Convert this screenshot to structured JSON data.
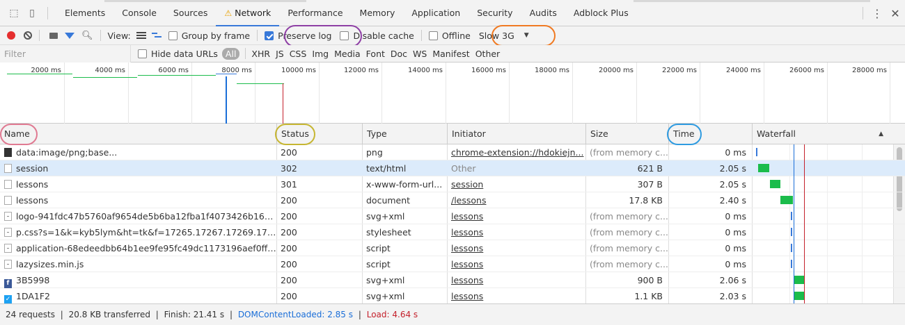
{
  "tabs": [
    "Elements",
    "Console",
    "Sources",
    "Network",
    "Performance",
    "Memory",
    "Application",
    "Security",
    "Audits",
    "Adblock Plus"
  ],
  "active_tab_index": 3,
  "toolbar": {
    "view_label": "View:",
    "group_by_frame": "Group by frame",
    "preserve_log": "Preserve log",
    "disable_cache": "Disable cache",
    "offline": "Offline",
    "throttle": "Slow 3G"
  },
  "filter": {
    "placeholder": "Filter",
    "hide_data_urls": "Hide data URLs",
    "types": [
      "All",
      "XHR",
      "JS",
      "CSS",
      "Img",
      "Media",
      "Font",
      "Doc",
      "WS",
      "Manifest",
      "Other"
    ]
  },
  "overview_ticks": [
    "2000 ms",
    "4000 ms",
    "6000 ms",
    "8000 ms",
    "10000 ms",
    "12000 ms",
    "14000 ms",
    "16000 ms",
    "18000 ms",
    "20000 ms",
    "22000 ms",
    "24000 ms",
    "26000 ms",
    "28000 ms"
  ],
  "columns": [
    "Name",
    "Status",
    "Type",
    "Initiator",
    "Size",
    "Time",
    "Waterfall"
  ],
  "rows": [
    {
      "icon": "image-file-icon",
      "name": "data:image/png;base...",
      "status": "200",
      "type": "png",
      "initiator": "chrome-extension://hdokiejn...",
      "initiator_link": true,
      "size": "(from memory c...",
      "time": "0 ms"
    },
    {
      "icon": "document-file-icon",
      "name": "session",
      "status": "302",
      "type": "text/html",
      "initiator": "Other",
      "initiator_link": false,
      "size": "621 B",
      "time": "2.05 s"
    },
    {
      "icon": "document-file-icon",
      "name": "lessons",
      "status": "301",
      "type": "x-www-form-url...",
      "initiator": "session",
      "initiator_link": true,
      "size": "307 B",
      "time": "2.05 s"
    },
    {
      "icon": "document-file-icon",
      "name": "lessons",
      "status": "200",
      "type": "document",
      "initiator": "/lessons",
      "initiator_link": true,
      "size": "17.8 KB",
      "time": "2.40 s"
    },
    {
      "icon": "svg-file-icon",
      "name": "logo-941fdc47b5760af9654de5b6ba12fba1f4073426b16b2ebbb...",
      "status": "200",
      "type": "svg+xml",
      "initiator": "lessons",
      "initiator_link": true,
      "size": "(from memory c...",
      "time": "0 ms"
    },
    {
      "icon": "stylesheet-file-icon",
      "name": "p.css?s=1&k=kyb5lym&ht=tk&f=17265.17267.17269.17272.22792.2...",
      "status": "200",
      "type": "stylesheet",
      "initiator": "lessons",
      "initiator_link": true,
      "size": "(from memory c...",
      "time": "0 ms"
    },
    {
      "icon": "script-file-icon",
      "name": "application-68edeedbb64b1ee9fe95fc49dc1173196aef0ff507b...",
      "status": "200",
      "type": "script",
      "initiator": "lessons",
      "initiator_link": true,
      "size": "(from memory c...",
      "time": "0 ms"
    },
    {
      "icon": "script-file-icon",
      "name": "lazysizes.min.js",
      "status": "200",
      "type": "script",
      "initiator": "lessons",
      "initiator_link": true,
      "size": "(from memory c...",
      "time": "0 ms"
    },
    {
      "icon": "facebook-icon",
      "name": "3B5998",
      "status": "200",
      "type": "svg+xml",
      "initiator": "lessons",
      "initiator_link": true,
      "size": "900 B",
      "time": "2.06 s"
    },
    {
      "icon": "twitter-icon",
      "name": "1DA1F2",
      "status": "200",
      "type": "svg+xml",
      "initiator": "lessons",
      "initiator_link": true,
      "size": "1.1 KB",
      "time": "2.03 s"
    }
  ],
  "statusbar": {
    "requests": "24 requests",
    "transferred": "20.8 KB transferred",
    "finish": "Finish: 21.41 s",
    "domcontentloaded": "DOMContentLoaded: 2.85 s",
    "load": "Load: 4.64 s",
    "separator": "|"
  },
  "colors": {
    "accent": "#3879d9",
    "record": "#e52f2f",
    "waterfall_bar": "#1bbc4b",
    "dom_line": "#1a6ed8",
    "load_line": "#c4202b"
  },
  "annotation_colors": {
    "preserve_log": "#8e3fa5",
    "throttle": "#f07a22",
    "name": "#e07a92",
    "status": "#c6b632",
    "time": "#2f9be0"
  }
}
